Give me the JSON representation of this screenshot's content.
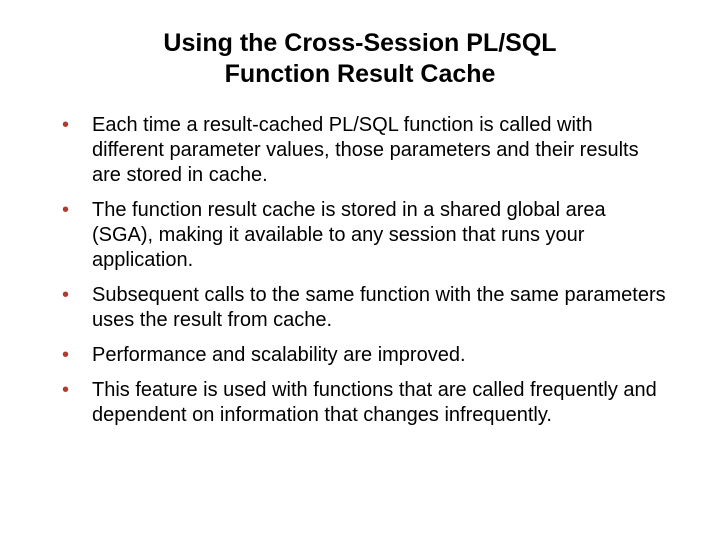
{
  "title_line1": "Using the Cross-Session PL/SQL",
  "title_line2": "Function Result Cache",
  "bullets": [
    "Each time a result-cached PL/SQL function is called with different parameter values, those parameters and their results are stored in cache.",
    "The function result cache is stored in a shared global area (SGA), making it available to any session that runs your application.",
    "Subsequent calls to the same function with the same parameters uses the result from cache.",
    "Performance and scalability are improved.",
    "This feature is used with functions that are called frequently and dependent on information that changes infrequently."
  ]
}
